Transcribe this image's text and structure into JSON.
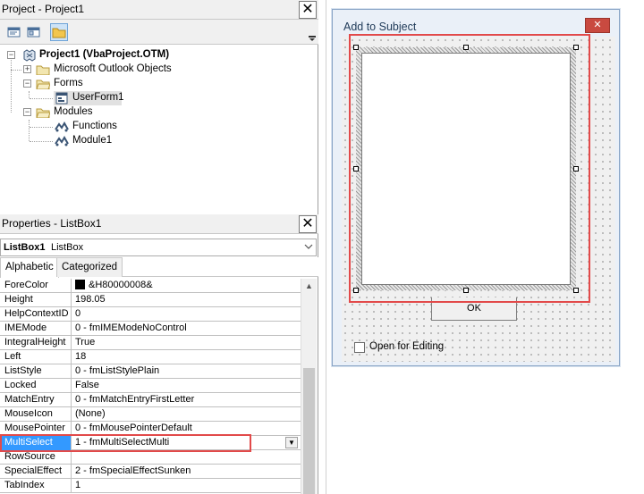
{
  "project": {
    "title": "Project - Project1",
    "close_glyph": "✕",
    "root": "Project1 (VbaProject.OTM)",
    "items": [
      {
        "label": "Microsoft Outlook Objects"
      },
      {
        "label": "Forms"
      },
      {
        "label": "UserForm1"
      },
      {
        "label": "Modules"
      },
      {
        "label": "Functions"
      },
      {
        "label": "Module1"
      }
    ]
  },
  "properties": {
    "title": "Properties - ListBox1",
    "close_glyph": "✕",
    "object_name": "ListBox1",
    "object_type": "ListBox",
    "tabs": [
      "Alphabetic",
      "Categorized"
    ],
    "rows": [
      {
        "name": "ForeColor",
        "value": "&H80000008&"
      },
      {
        "name": "Height",
        "value": "198.05"
      },
      {
        "name": "HelpContextID",
        "value": "0"
      },
      {
        "name": "IMEMode",
        "value": "0 - fmIMEModeNoControl"
      },
      {
        "name": "IntegralHeight",
        "value": "True"
      },
      {
        "name": "Left",
        "value": "18"
      },
      {
        "name": "ListStyle",
        "value": "0 - fmListStylePlain"
      },
      {
        "name": "Locked",
        "value": "False"
      },
      {
        "name": "MatchEntry",
        "value": "0 - fmMatchEntryFirstLetter"
      },
      {
        "name": "MouseIcon",
        "value": "(None)"
      },
      {
        "name": "MousePointer",
        "value": "0 - fmMousePointerDefault"
      },
      {
        "name": "MultiSelect",
        "value": "1 - fmMultiSelectMulti"
      },
      {
        "name": "RowSource",
        "value": ""
      },
      {
        "name": "SpecialEffect",
        "value": "2 - fmSpecialEffectSunken"
      },
      {
        "name": "TabIndex",
        "value": "1"
      }
    ],
    "selected_row": "MultiSelect"
  },
  "form": {
    "title": "Add to Subject",
    "close_glyph": "✕",
    "ok_label": "OK",
    "checkbox_label": "Open for Editing",
    "checkbox_checked": false
  },
  "colors": {
    "highlight_box": "#e24a4a",
    "selection": "#3399ff",
    "dialog_close": "#c94a40"
  }
}
